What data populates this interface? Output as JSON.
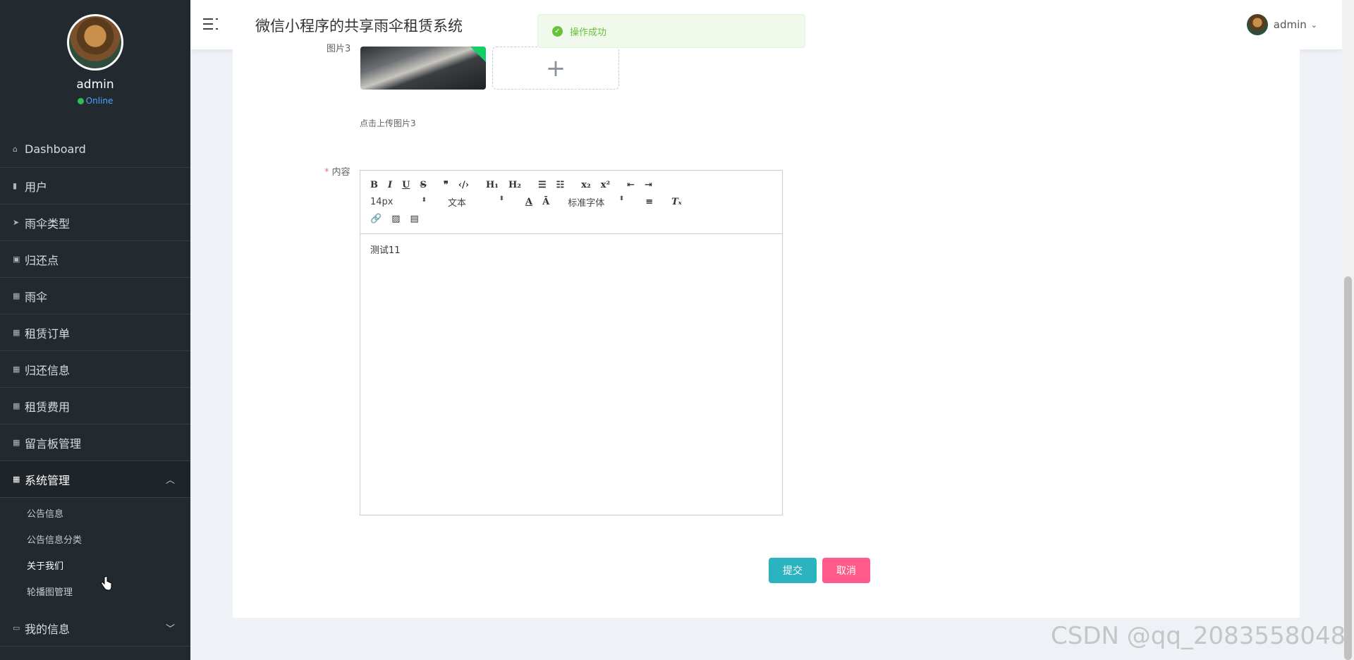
{
  "app": {
    "title": "微信小程序的共享雨伞租赁系统"
  },
  "profile": {
    "name": "admin",
    "status": "Online"
  },
  "sidebar": {
    "items": [
      {
        "label": "Dashboard",
        "icon": "home-icon"
      },
      {
        "label": "用户",
        "icon": "book-icon"
      },
      {
        "label": "雨伞类型",
        "icon": "paper-plane-icon"
      },
      {
        "label": "归还点",
        "icon": "clipboard-icon"
      },
      {
        "label": "雨伞",
        "icon": "grid-icon"
      },
      {
        "label": "租赁订单",
        "icon": "grid-icon"
      },
      {
        "label": "归还信息",
        "icon": "grid-icon"
      },
      {
        "label": "租赁费用",
        "icon": "grid-icon"
      },
      {
        "label": "留言板管理",
        "icon": "grid-icon"
      },
      {
        "label": "系统管理",
        "icon": "grid-icon"
      },
      {
        "label": "我的信息",
        "icon": "id-card-icon"
      }
    ],
    "submenu": [
      "公告信息",
      "公告信息分类",
      "关于我们",
      "轮播图管理"
    ]
  },
  "header": {
    "user": "admin"
  },
  "toast": {
    "message": "操作成功"
  },
  "form": {
    "image_label": "图片3",
    "upload_tip": "点击上传图片3",
    "content_label": "内容",
    "editor": {
      "font_size": "14px",
      "heading": "文本",
      "font_family": "标准字体",
      "body": "测试11"
    },
    "submit_label": "提交",
    "cancel_label": "取消"
  },
  "watermark": "CSDN @qq_2083558048"
}
